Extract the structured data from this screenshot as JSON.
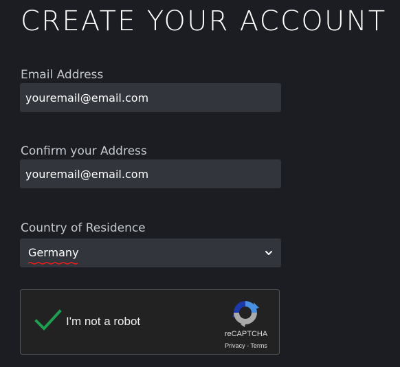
{
  "page": {
    "title": "CREATE YOUR ACCOUNT"
  },
  "form": {
    "email_label": "Email Address",
    "email_value": "youremail@email.com",
    "confirm_label": "Confirm your Address",
    "confirm_value": "youremail@email.com",
    "country_label": "Country of Residence",
    "country_value": "Germany"
  },
  "captcha": {
    "checkbox_label": "I'm not a robot",
    "brand": "reCAPTCHA",
    "privacy": "Privacy",
    "separator": " - ",
    "terms": "Terms",
    "checked": true
  },
  "icons": {
    "checkmark": "checkmark-icon",
    "dropdown": "chevron-down-icon",
    "recaptcha": "recaptcha-logo-icon"
  },
  "colors": {
    "background": "#1b1d22",
    "field_bg": "#32353c",
    "checkmark": "#1e9e50",
    "spellcheck_underline": "#e02020"
  }
}
